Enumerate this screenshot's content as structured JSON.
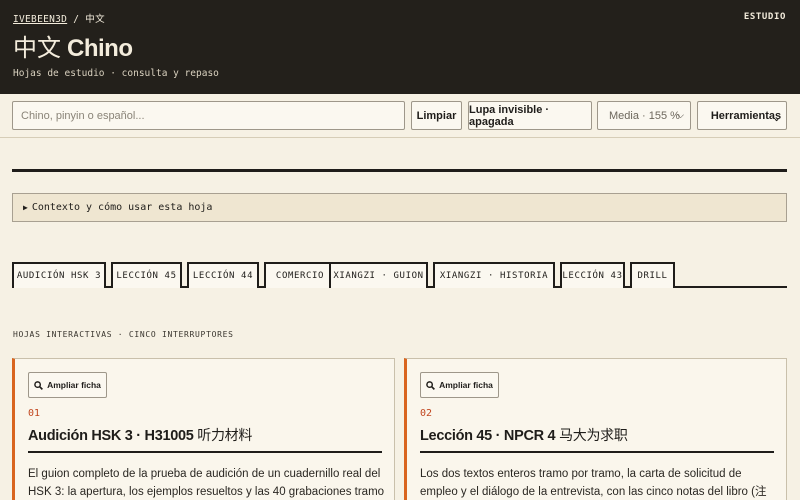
{
  "header": {
    "breadcrumb_home": "IVEBEEN3D",
    "breadcrumb_sep": "/",
    "breadcrumb_current": "中文",
    "nav_right": "ESTUDIO",
    "title_hanzi": "中文",
    "title_latin": "Chino",
    "subtitle": "Hojas de estudio · consulta y repaso"
  },
  "toolbar": {
    "search_placeholder": "Chino, pinyin o español...",
    "clear_label": "Limpiar",
    "lupa_label": "Lupa invisible · apagada",
    "size_select": "Media · 155 %",
    "tools_label": "Herramientas"
  },
  "details": {
    "summary": "Contexto y cómo usar esta hoja"
  },
  "tabs": [
    {
      "label": "AUDICIÓN HSK 3"
    },
    {
      "label": "LECCIÓN 45"
    },
    {
      "label": "LECCIÓN 44"
    },
    {
      "label": "COMERCIO"
    },
    {
      "label": "XIANGZI · GUION"
    },
    {
      "label": "XIANGZI · HISTORIA"
    },
    {
      "label": "LECCIÓN 43"
    },
    {
      "label": "DRILL"
    }
  ],
  "section_label": "HOJAS INTERACTIVAS · CINCO INTERRUPTORES",
  "cards": [
    {
      "button": "Ampliar ficha",
      "number": "01",
      "title": "Audición HSK 3 · H31005",
      "title_cn": "听力材料",
      "text": "El guion completo de la prueba de audición de un cuadernillo real del HSK 3: la apertura, los ejemplos resueltos y las 40 grabaciones tramo"
    },
    {
      "button": "Ampliar ficha",
      "number": "02",
      "title": "Lección 45 · NPCR 4",
      "title_cn": "马大为求职",
      "text": "Los dos textos enteros tramo por tramo, la carta de solicitud de empleo y el diálogo de la entrevista, con las cinco notas del libro (注"
    }
  ],
  "colors": {
    "header_bg": "#23201b",
    "page_bg": "#f6f1e4",
    "accent": "#d9651f",
    "number": "#c1461f"
  }
}
